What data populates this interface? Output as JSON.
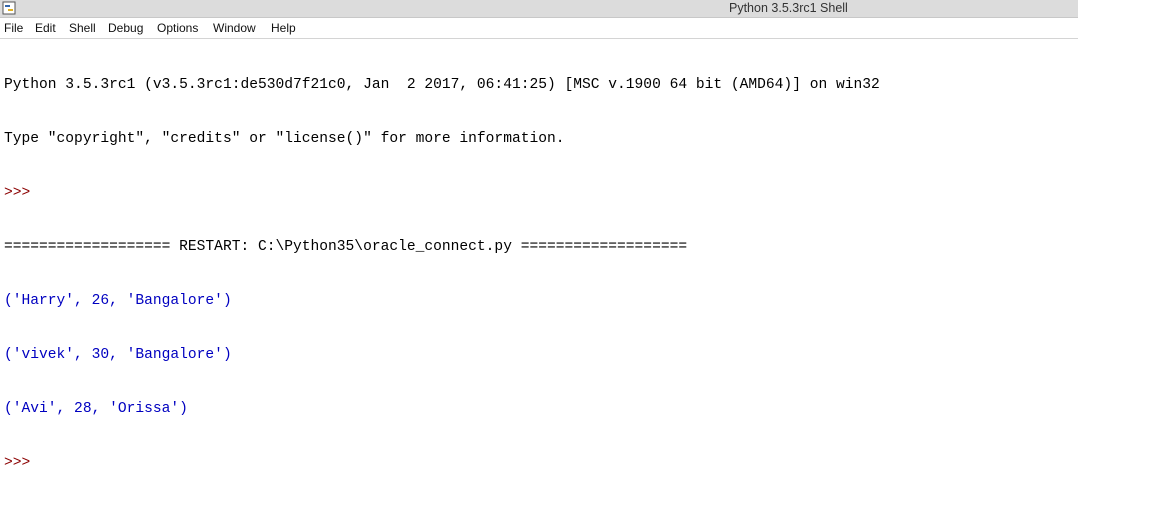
{
  "window": {
    "title": "Python 3.5.3rc1 Shell",
    "icon": "python-idle-icon"
  },
  "menu": {
    "items": [
      "File",
      "Edit",
      "Shell",
      "Debug",
      "Options",
      "Window",
      "Help"
    ]
  },
  "shell": {
    "banner_line1": "Python 3.5.3rc1 (v3.5.3rc1:de530d7f21c0, Jan  2 2017, 06:41:25) [MSC v.1900 64 bit (AMD64)] on win32",
    "banner_line2": "Type \"copyright\", \"credits\" or \"license()\" for more information.",
    "prompt1": ">>> ",
    "restart_line": "=================== RESTART: C:\\Python35\\oracle_connect.py ===================",
    "output": [
      "('Harry', 26, 'Bangalore')",
      "('vivek', 30, 'Bangalore')",
      "('Avi', 28, 'Orissa')"
    ],
    "prompt2": ">>> "
  },
  "colors": {
    "prompt": "#8b0000",
    "output": "#0000c0",
    "text": "#000000"
  }
}
